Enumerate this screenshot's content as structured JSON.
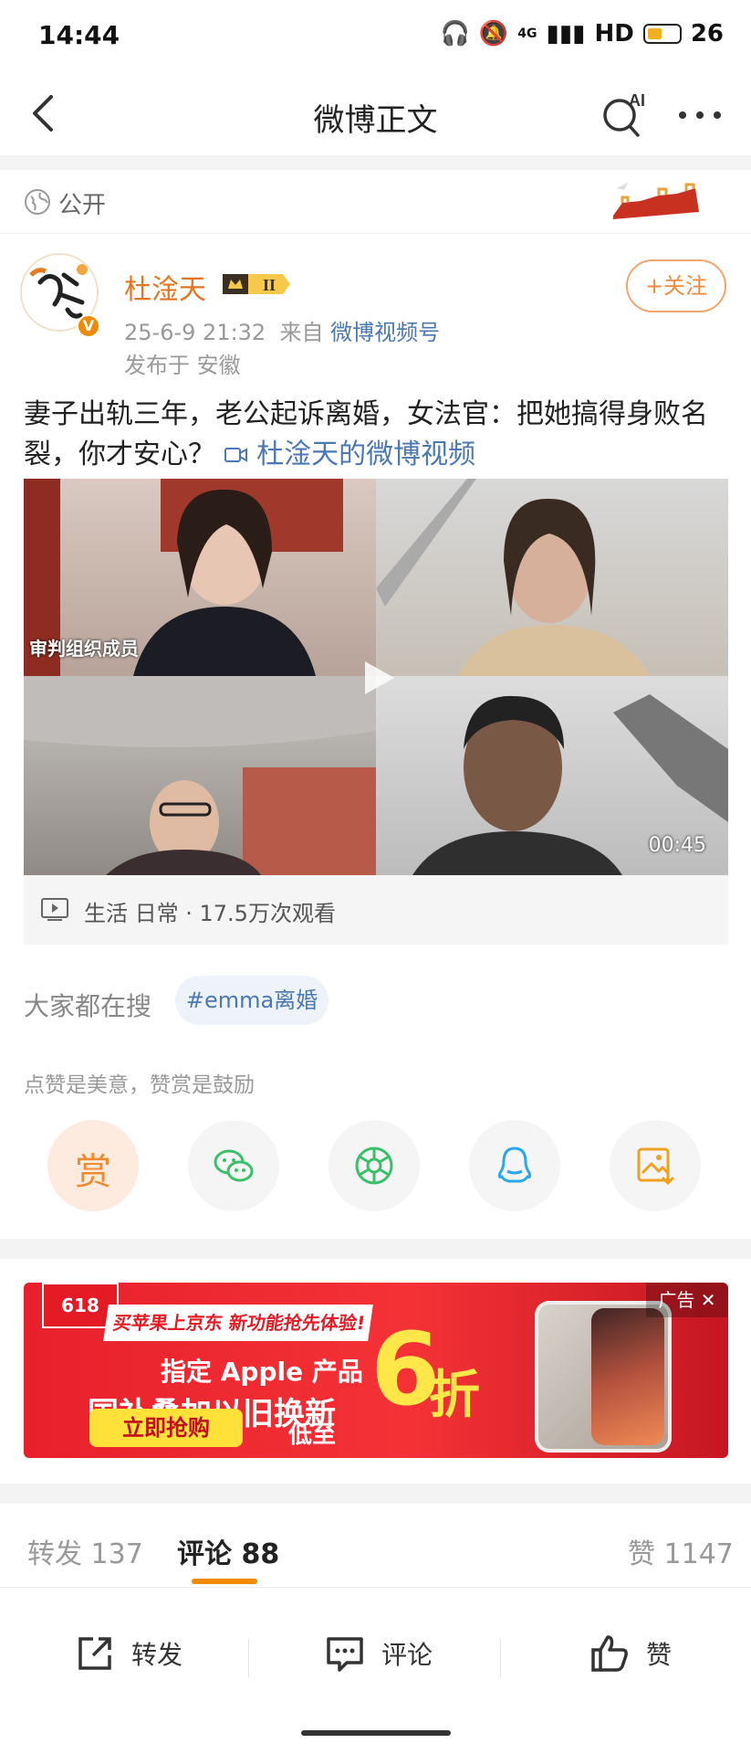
{
  "status_bar": {
    "time": "14:44",
    "network": "4G",
    "hd": "HD",
    "battery": "26"
  },
  "nav": {
    "title": "微博正文",
    "ai_label": "AI"
  },
  "visibility": {
    "label": "公开"
  },
  "author": {
    "name": "杜淦天",
    "level": "II",
    "verified": "V",
    "date": "25-6-9 21:32",
    "from_prefix": "来自",
    "source": "微博视频号",
    "location": "发布于 安徽",
    "follow_label": "+关注"
  },
  "post": {
    "text": "妻子出轨三年，老公起诉离婚，女法官：把她搞得身败名裂，你才安心？",
    "video_link": "杜淦天的微博视频"
  },
  "video": {
    "tile_label": "审判组织成员",
    "duration": "00:45",
    "info": "生活 日常 · 17.5万次观看"
  },
  "search": {
    "label": "大家都在搜",
    "tag": "#emma离婚"
  },
  "encourage_text": "点赞是美意，赞赏是鼓励",
  "share_actions": [
    "赏",
    "wechat-icon",
    "moments-icon",
    "qq-icon",
    "save-image-icon"
  ],
  "ad": {
    "badge": "618",
    "tagline": "买苹果上京东 新功能抢先体验!",
    "line1": "指定 Apple 产品",
    "line2": "国补叠加以旧换新",
    "low": "低至",
    "big": "6",
    "discount_unit": "折",
    "cta": "立即抢购",
    "ad_label": "广告 ✕"
  },
  "tabs": {
    "repost": "转发 137",
    "comment": "评论 88",
    "like": "赞 1147"
  },
  "bottom_bar": {
    "repost": "转发",
    "comment": "评论",
    "like": "赞"
  },
  "colors": {
    "accent": "#f08a00",
    "link": "#4a78b5",
    "name": "#e8731e"
  }
}
